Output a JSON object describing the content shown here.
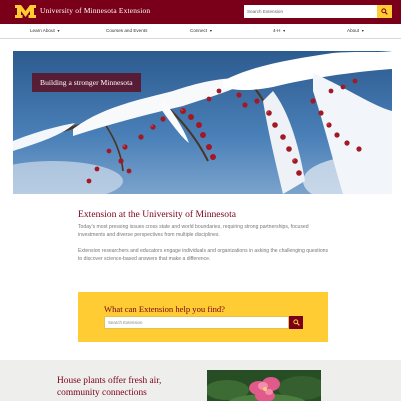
{
  "header": {
    "site_title": "University of Minnesota Extension",
    "search_placeholder": "Search Extension",
    "search_icon": "search-icon"
  },
  "nav": {
    "items": [
      {
        "label": "Learn About"
      },
      {
        "label": "Courses and Events"
      },
      {
        "label": "Connect"
      },
      {
        "label": "4-H"
      },
      {
        "label": "About"
      }
    ]
  },
  "hero": {
    "caption": "Building a stronger Minnesota",
    "image": "snow-covered branches with red berries"
  },
  "intro": {
    "heading": "Extension at the University of Minnesota",
    "paragraph1": "Today's most pressing issues cross state and world boundaries, requiring strong partnerships, focused investments and diverse perspectives from multiple disciplines.",
    "paragraph2": "Extension researchers and educators engage individuals and organizations in asking the challenging questions to discover science-based answers that make a difference."
  },
  "help": {
    "heading": "What can Extension help you find?",
    "search_placeholder": "Search Extension",
    "search_icon": "search-icon"
  },
  "feature": {
    "heading": "House plants offer fresh air, community connections",
    "image": "pink flower with green leaves"
  },
  "colors": {
    "maroon": "#7a0019",
    "gold": "#ffcc33",
    "feature_bg": "#eeeeec"
  }
}
